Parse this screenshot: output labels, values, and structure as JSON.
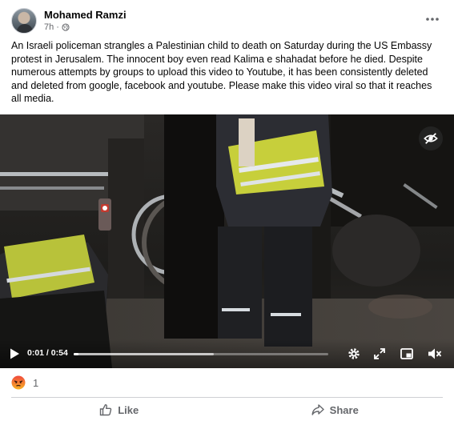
{
  "post": {
    "author": "Mohamed Ramzi",
    "time": "7h",
    "privacy_icon": "globe-icon",
    "more_icon": "more-horizontal-icon",
    "text": "An Israeli policeman strangles a Palestinian child to death on Saturday during the US Embassy protest in Jerusalem. The innocent boy even read Kalima e shahadat before he died. Despite numerous attempts by groups to upload this video to Youtube, it has been consistently deleted and deleted from google, facebook and youtube. Please make this video viral so that it reaches all media."
  },
  "video": {
    "hide_icon": "eye-slash-icon",
    "time_display": "0:01 / 0:54",
    "current_time": "0:01",
    "duration": "0:54",
    "played_fraction": 0.02,
    "buffered_fraction": 0.55,
    "controls": [
      "play-icon",
      "settings-gear-icon",
      "expand-icon",
      "picture-in-picture-icon",
      "mute-icon"
    ]
  },
  "reactions": {
    "icon": "angry-reaction-icon",
    "count": "1"
  },
  "actions": {
    "like_label": "Like",
    "share_label": "Share"
  },
  "colors": {
    "text_primary": "#050505",
    "text_secondary": "#65676b",
    "divider": "#ced0d4",
    "angry": "#e9710f",
    "vest_yellow": "#c9d33a"
  }
}
